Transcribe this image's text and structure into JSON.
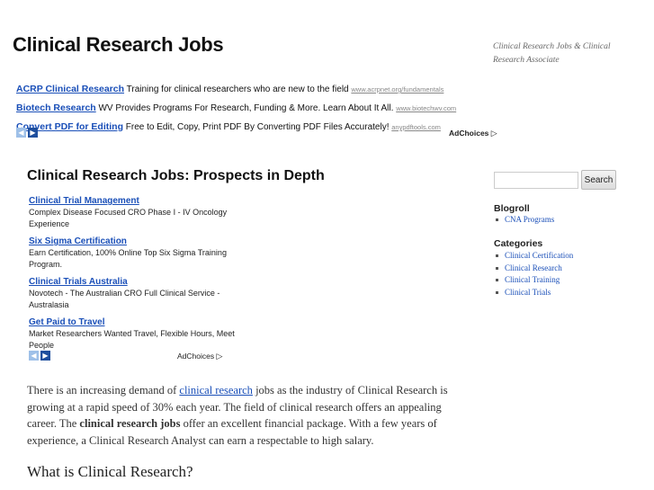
{
  "site": {
    "title": "Clinical Research Jobs",
    "tagline": "Clinical Research Jobs & Clinical Research Associate"
  },
  "top_ads": [
    {
      "title": "ACRP Clinical Research",
      "text": "Training for clinical researchers who are new to the field",
      "url": "www.acrpnet.org/fundamentals"
    },
    {
      "title": "Biotech Research",
      "text": "WV Provides Programs For Research, Funding & More. Learn About It All.",
      "url": "www.biotechwv.com"
    },
    {
      "title": "Convert PDF for Editing",
      "text": "Free to Edit, Copy, Print PDF By Converting PDF Files Accurately!",
      "url": "anypdftools.com"
    }
  ],
  "adchoices_label": "AdChoices",
  "adchoices_icon": "▷",
  "arrows": {
    "prev": "◀",
    "next": "▶"
  },
  "post": {
    "title": "Clinical Research Jobs: Prospects in Depth",
    "p1_before": "There is an increasing demand of ",
    "p1_link": "clinical research",
    "p1_middle": " jobs as the industry of Clinical Research is growing at a rapid speed of 30% each year. The field of clinical research offers an appealing career. The ",
    "p1_bold": "clinical research jobs",
    "p1_after": " offer an excellent financial package. With a few years of experience, a Clinical Research Analyst can earn a respectable to high salary.",
    "subheading": "What is Clinical Research?"
  },
  "side_ads": [
    {
      "title": "Clinical Trial Management",
      "text": "Complex Disease Focused CRO Phase I - IV Oncology Experience"
    },
    {
      "title": "Six Sigma Certification",
      "text": "Earn Certification, 100% Online Top Six Sigma Training Program."
    },
    {
      "title": "Clinical Trials Australia",
      "text": "Novotech - The Australian CRO Full Clinical Service - Australasia"
    },
    {
      "title": "Get Paid to Travel",
      "text": "Market Researchers Wanted Travel, Flexible Hours, Meet People"
    }
  ],
  "sidebar": {
    "search_value": "",
    "search_button": "Search",
    "blogroll_title": "Blogroll",
    "blogroll": [
      "CNA Programs"
    ],
    "categories_title": "Categories",
    "categories": [
      "Clinical Certification",
      "Clinical Research",
      "Clinical Training",
      "Clinical Trials"
    ]
  },
  "colors": {
    "link": "#1a4fb8",
    "arrow_dark": "#1f4f9e",
    "arrow_light": "#9ec0e8"
  }
}
